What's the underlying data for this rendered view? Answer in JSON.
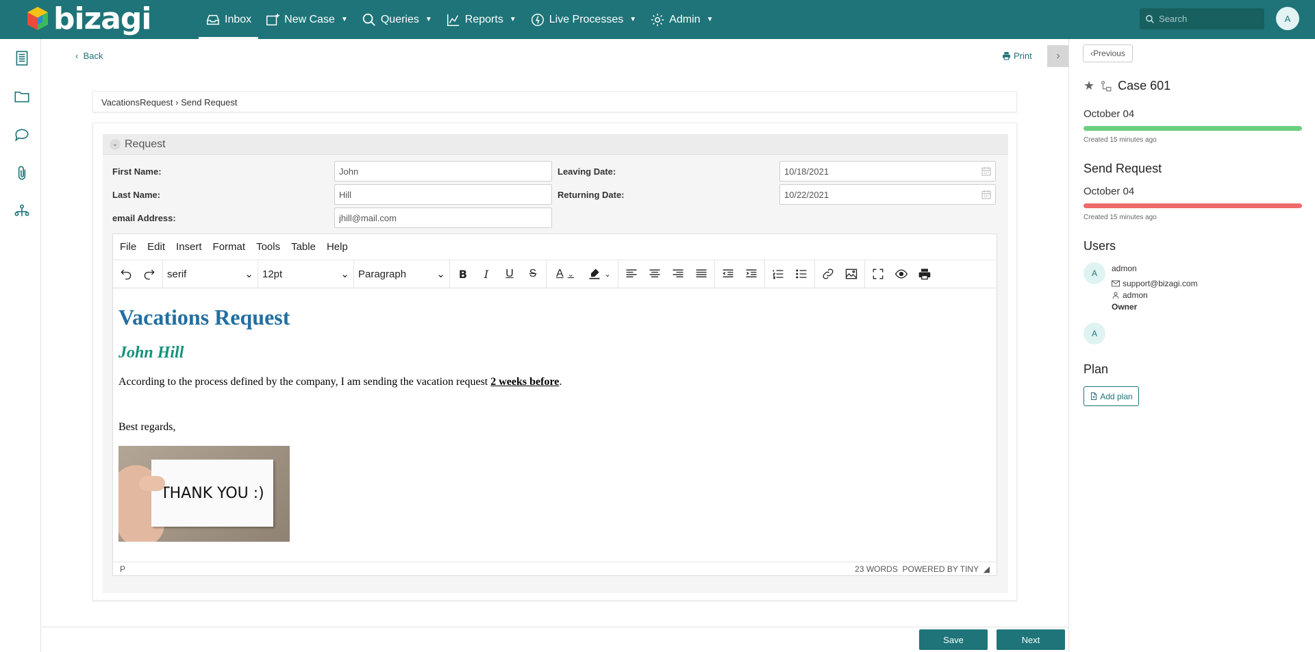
{
  "brand": {
    "name": "bizagi",
    "accent": "#1e7478"
  },
  "nav": {
    "items": [
      {
        "label": "Inbox",
        "icon": "inbox-icon",
        "active": true
      },
      {
        "label": "New Case",
        "icon": "new-case-icon"
      },
      {
        "label": "Queries",
        "icon": "search-icon"
      },
      {
        "label": "Reports",
        "icon": "chart-icon"
      },
      {
        "label": "Live Processes",
        "icon": "live-processes-icon"
      },
      {
        "label": "Admin",
        "icon": "gear-icon"
      }
    ],
    "search_placeholder": "Search",
    "user_initial": "A"
  },
  "leftbar": {
    "icons": [
      "document-icon",
      "folder-icon",
      "chat-icon",
      "paperclip-icon",
      "process-icon"
    ],
    "expand_icon": "double-chevron-right-icon"
  },
  "page": {
    "back_label": "Back",
    "print_label": "Print",
    "breadcrumb": "VacationsRequest › Send Request"
  },
  "form": {
    "group_title": "Request",
    "fields": {
      "first_name": {
        "label": "First Name:",
        "value": "John"
      },
      "last_name": {
        "label": "Last Name:",
        "value": "Hill"
      },
      "email": {
        "label": "email Address:",
        "value": "jhill@mail.com"
      },
      "leaving_date": {
        "label": "Leaving Date:",
        "value": "10/18/2021"
      },
      "returning_date": {
        "label": "Returning Date:",
        "value": "10/22/2021"
      }
    }
  },
  "editor": {
    "menu": [
      "File",
      "Edit",
      "Insert",
      "Format",
      "Tools",
      "Table",
      "Help"
    ],
    "font_family": "serif",
    "font_size": "12pt",
    "block_format": "Paragraph",
    "content": {
      "heading": "Vacations Request",
      "subheading": "John Hill",
      "paragraph_before": "According to the process defined by the company, I am sending the vacation request ",
      "paragraph_emphasis": "2 weeks before",
      "paragraph_after": ".",
      "closing": "Best regards,",
      "image_text": "THANK YOU :)"
    },
    "status_path": "P",
    "word_count": "23 WORDS",
    "powered_by": "POWERED BY TINY"
  },
  "footer": {
    "save_label": "Save",
    "next_label": "Next"
  },
  "side": {
    "previous_label": "Previous",
    "case_title": "Case 601",
    "process_date": "October 04",
    "process_created": "Created 15 minutes ago",
    "process_progress": 1.0,
    "process_color": "#6ccf7f",
    "task_title": "Send Request",
    "task_date": "October 04",
    "task_created": "Created 15 minutes ago",
    "task_progress": 1.0,
    "task_color": "#ef6b6b",
    "users_title": "Users",
    "user": {
      "initial": "A",
      "name": "admon",
      "email": "support@bizagi.com",
      "login": "admon",
      "role": "Owner"
    },
    "user2_initial": "A",
    "plan_title": "Plan",
    "add_plan_label": "Add plan"
  }
}
